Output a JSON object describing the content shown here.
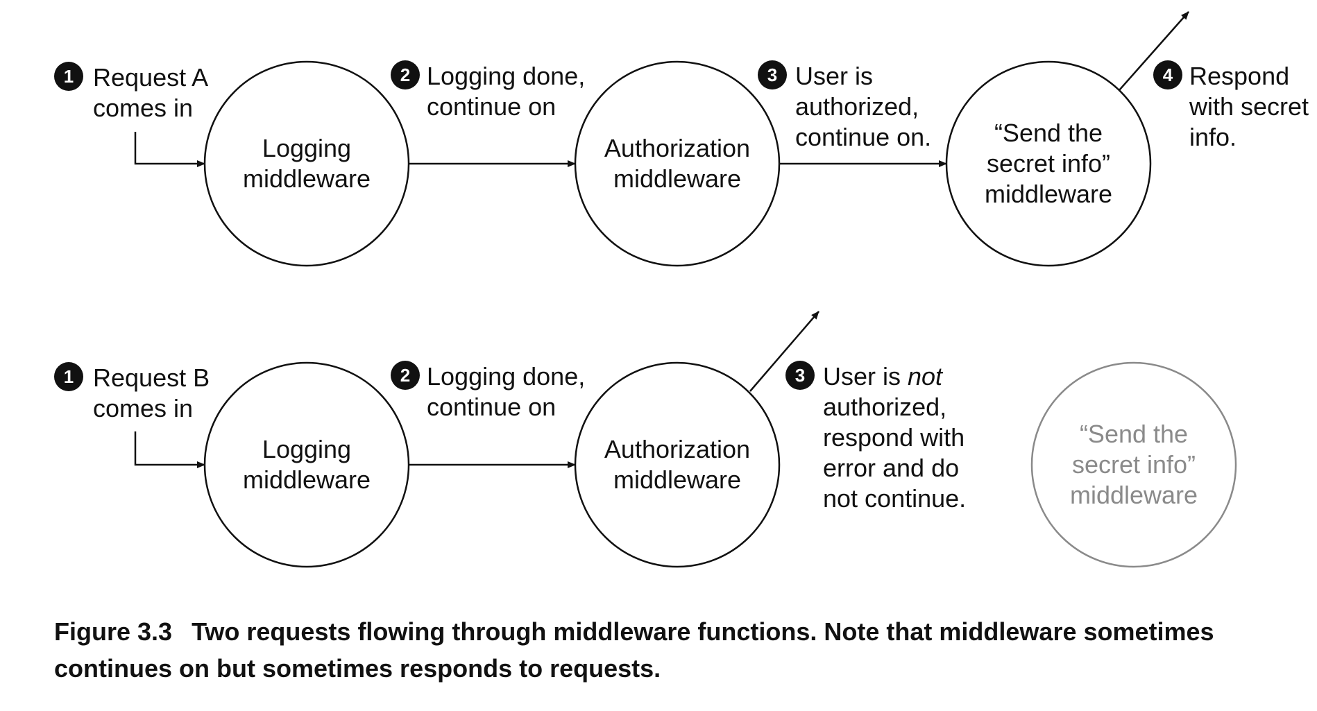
{
  "rows": [
    {
      "steps": [
        {
          "badge": "1",
          "lines": [
            "Request A",
            "comes in"
          ]
        },
        {
          "badge": "2",
          "lines": [
            "Logging done,",
            "continue on"
          ]
        },
        {
          "badge": "3",
          "lines": [
            "User is",
            "authorized,",
            "continue on."
          ]
        },
        {
          "badge": "4",
          "lines": [
            "Respond",
            "with secret",
            "info."
          ]
        }
      ],
      "nodes": [
        {
          "lines": [
            "Logging",
            "middleware"
          ],
          "active": true
        },
        {
          "lines": [
            "Authorization",
            "middleware"
          ],
          "active": true
        },
        {
          "lines": [
            "“Send the",
            "secret info”",
            "middleware"
          ],
          "active": true
        }
      ]
    },
    {
      "steps": [
        {
          "badge": "1",
          "lines": [
            "Request B",
            "comes in"
          ]
        },
        {
          "badge": "2",
          "lines": [
            "Logging done,",
            "continue on"
          ]
        },
        {
          "badge": "3",
          "lines": [
            [
              "User is ",
              "not"
            ],
            "authorized,",
            "respond with",
            "error and do",
            "not continue."
          ]
        }
      ],
      "nodes": [
        {
          "lines": [
            "Logging",
            "middleware"
          ],
          "active": true
        },
        {
          "lines": [
            "Authorization",
            "middleware"
          ],
          "active": true
        },
        {
          "lines": [
            "“Send the",
            "secret info”",
            "middleware"
          ],
          "active": false
        }
      ]
    }
  ],
  "caption": {
    "label": "Figure 3.3",
    "text": "Two requests flowing through middleware functions. Note that middleware sometimes continues on but sometimes responds to requests."
  },
  "colors": {
    "ink": "#111111",
    "inactive": "#8a8a8a"
  }
}
